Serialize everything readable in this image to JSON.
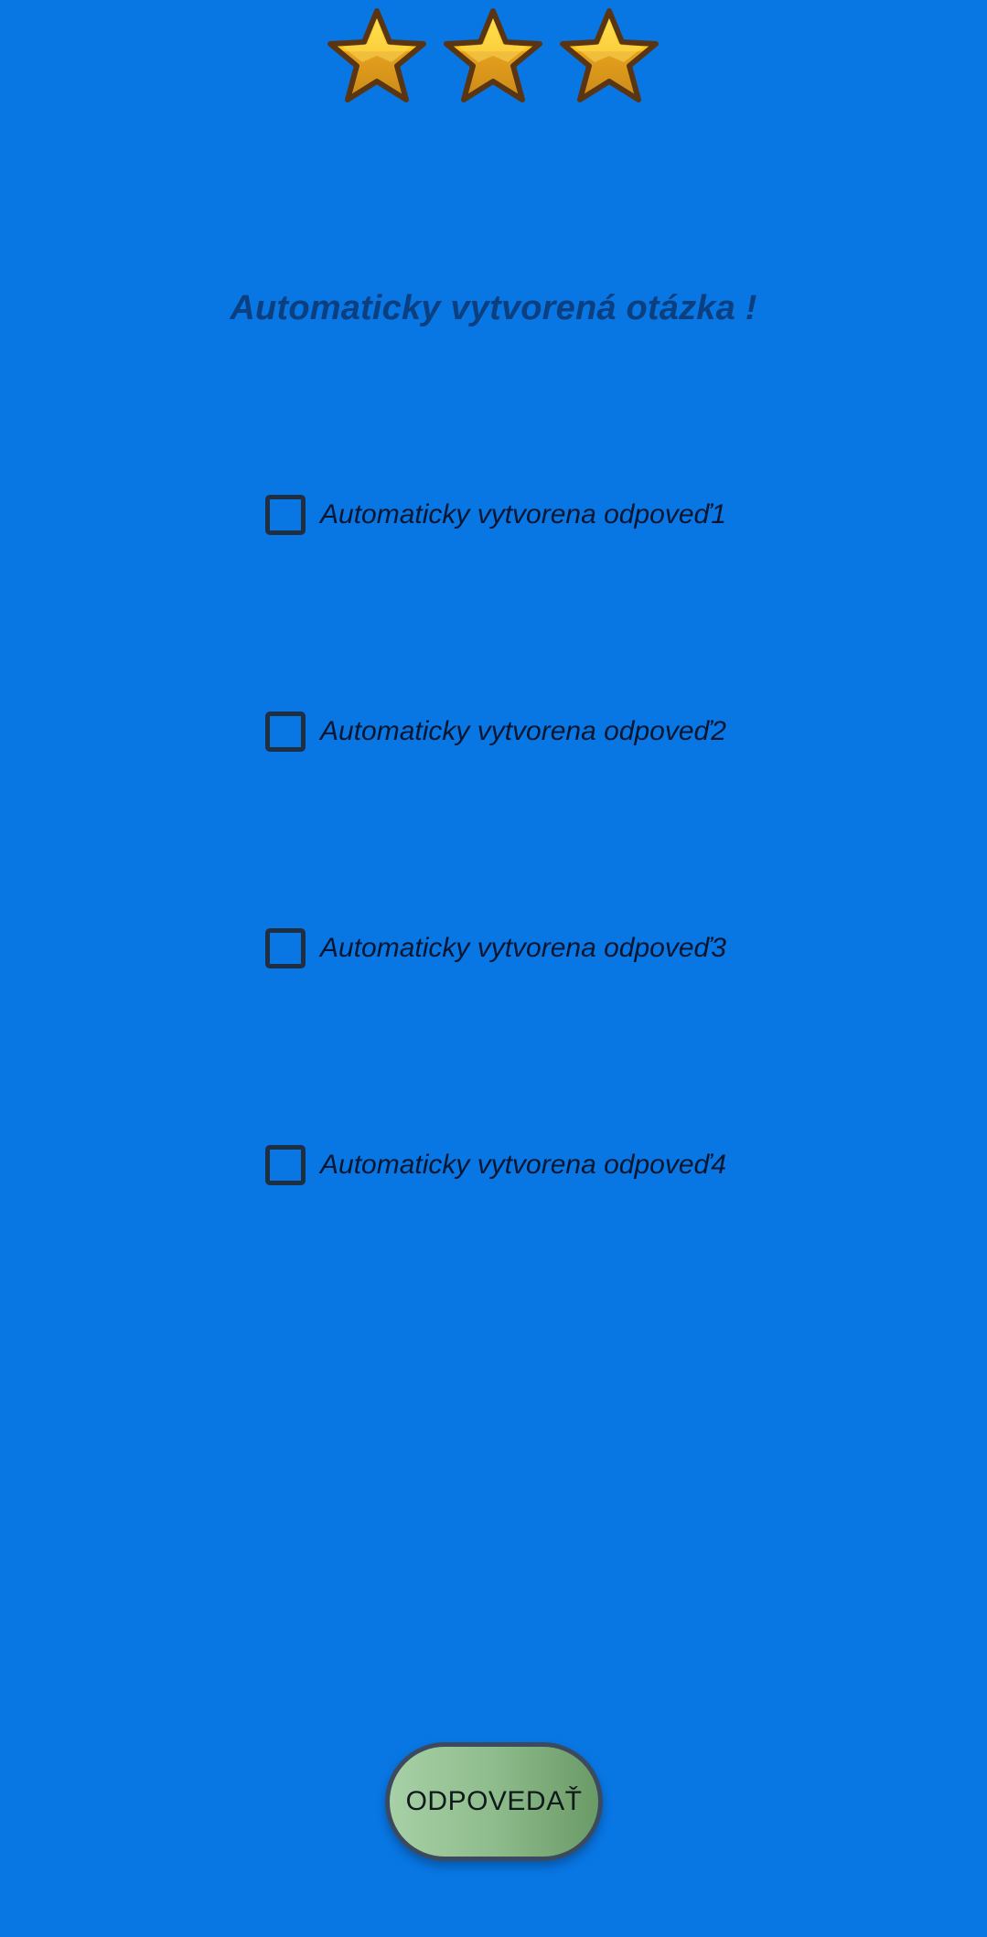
{
  "rating": {
    "stars": [
      {
        "icon": "star-icon",
        "filled": true
      },
      {
        "icon": "star-icon",
        "filled": true
      },
      {
        "icon": "star-icon",
        "filled": true
      }
    ],
    "value": 3,
    "max": 3
  },
  "question": {
    "text": "Automaticky vytvorená otázka !"
  },
  "answers": [
    {
      "label": "Automaticky vytvorena odpoveď1",
      "checked": false
    },
    {
      "label": "Automaticky vytvorena odpoveď2",
      "checked": false
    },
    {
      "label": "Automaticky vytvorena odpoveď3",
      "checked": false
    },
    {
      "label": "Automaticky vytvorena odpoveď4",
      "checked": false
    }
  ],
  "submit": {
    "label": "ODPOVEDAŤ"
  },
  "colors": {
    "background": "#0876e3",
    "question_text": "#0b3f80",
    "star_fill": "#f5b400",
    "button_gradient_start": "#a7d0a6",
    "button_gradient_end": "#6a9a66"
  }
}
